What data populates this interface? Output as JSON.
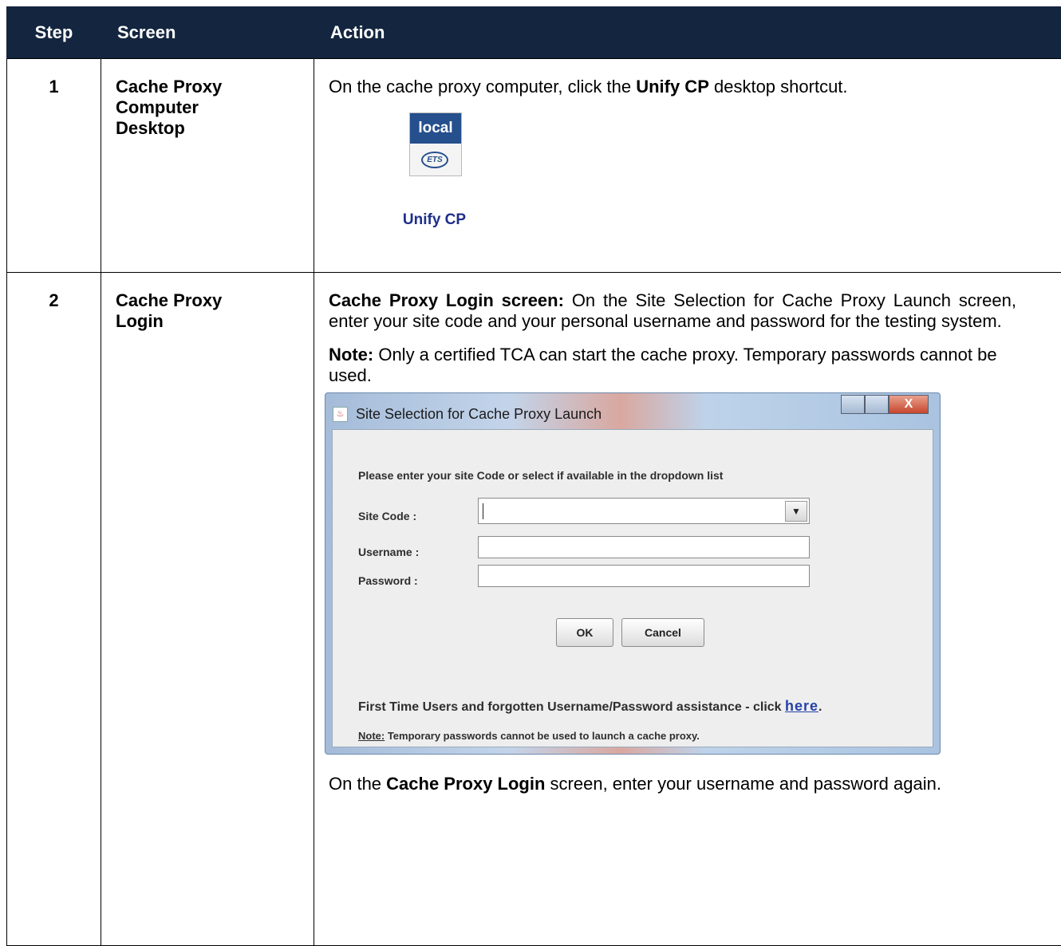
{
  "headers": {
    "step": "Step",
    "screen": "Screen",
    "action": "Action"
  },
  "row1": {
    "step": "1",
    "screen": [
      "Cache Proxy",
      "Computer",
      "Desktop"
    ],
    "action_pre": "On the cache proxy computer, click the ",
    "action_bold": "Unify CP",
    "action_post": " desktop shortcut.",
    "icon": {
      "name": "unify-cp-shortcut-icon",
      "top_text": "local",
      "logo_text": "ETS",
      "label": "Unify CP"
    }
  },
  "row2": {
    "step": "2",
    "screen": [
      "Cache Proxy",
      "Login"
    ],
    "p1_bold": "Cache Proxy Login screen:",
    "p1_text": " On the Site Selection for Cache Proxy Launch screen, enter your site code and your personal username and password for the testing system.",
    "note_bold": "Note:",
    "note_text": " Only a certified TCA can start the cache proxy. Temporary passwords cannot be used.",
    "p3_pre": "On the ",
    "p3_bold": "Cache Proxy Login",
    "p3_post": " screen, enter your username and password again.",
    "dialog": {
      "title": "Site Selection for Cache Proxy Launch",
      "close_glyph": "X",
      "instruction": "Please enter your site Code or select if available in the dropdown list",
      "site_code_label": "Site Code :",
      "site_code_value": "",
      "username_label": "Username :",
      "username_value": "",
      "password_label": "Password :",
      "password_value": "",
      "ok": "OK",
      "cancel": "Cancel",
      "help_text": "First Time Users and forgotten Username/Password assistance - click ",
      "help_link": "here",
      "help_end": ".",
      "note_label": "Note:",
      "note_text": " Temporary passwords cannot be used to launch a cache proxy."
    }
  }
}
